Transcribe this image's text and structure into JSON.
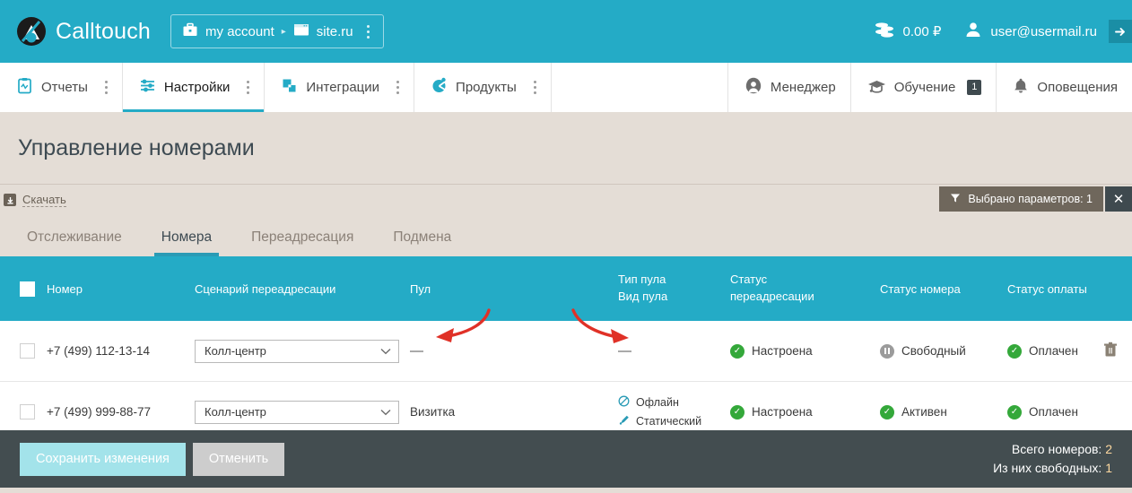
{
  "brand": {
    "name": "Calltouch",
    "logo_icon": "calltouch-logo-icon"
  },
  "topbar": {
    "account": {
      "icon": "briefcase-icon",
      "label": "my account",
      "separator": "▸"
    },
    "site": {
      "icon": "browser-window-icon",
      "label": "site.ru"
    },
    "menu_icon": "kebab-menu-icon",
    "balance": {
      "icon": "coins-icon",
      "value": "0.00 ₽"
    },
    "user": {
      "icon": "user-icon",
      "email": "user@usermail.ru"
    },
    "logout_icon": "logout-arrow-icon"
  },
  "nav": {
    "items": [
      {
        "label": "Отчеты",
        "icon": "reports-clipboard-icon",
        "active": false,
        "has_menu": true
      },
      {
        "label": "Настройки",
        "icon": "settings-sliders-icon",
        "active": true,
        "has_menu": true
      },
      {
        "label": "Интеграции",
        "icon": "integrations-squares-icon",
        "active": false,
        "has_menu": true
      },
      {
        "label": "Продукты",
        "icon": "products-icon",
        "active": false,
        "has_menu": true
      }
    ],
    "right_items": [
      {
        "label": "Менеджер",
        "icon": "manager-headset-icon",
        "badge": ""
      },
      {
        "label": "Обучение",
        "icon": "graduation-cap-icon",
        "badge": "1"
      },
      {
        "label": "Оповещения",
        "icon": "bell-icon",
        "badge": ""
      }
    ]
  },
  "page": {
    "title": "Управление номерами",
    "download": {
      "label": "Скачать",
      "icon": "download-icon"
    },
    "filter_chip": {
      "icon": "filter-funnel-icon",
      "label": "Выбрано параметров: 1",
      "close_icon": "close-icon"
    }
  },
  "subtabs": [
    {
      "label": "Отслеживание",
      "active": false
    },
    {
      "label": "Номера",
      "active": true
    },
    {
      "label": "Переадресация",
      "active": false
    },
    {
      "label": "Подмена",
      "active": false
    }
  ],
  "table": {
    "headers": {
      "number": "Номер",
      "scenario": "Сценарий переадресации",
      "pool": "Пул",
      "pool_type_1": "Тип пула",
      "pool_type_2": "Вид пула",
      "fwd_status_1": "Статус",
      "fwd_status_2": "переадресации",
      "number_status": "Статус номера",
      "payment_status": "Статус оплаты"
    },
    "rows": [
      {
        "number": "+7 (499) 112-13-14",
        "scenario": "Колл-центр",
        "pool": "—",
        "pool_type": "—",
        "pool_kind": "",
        "fwd_status": "Настроена",
        "number_status": "Свободный",
        "number_status_icon": "pause-circle-icon",
        "payment_status": "Оплачен",
        "delete_icon": "trash-icon",
        "has_delete": true
      },
      {
        "number": "+7 (499) 999-88-77",
        "scenario": "Колл-центр",
        "pool": "Визитка",
        "pool_type": "Офлайн",
        "pool_kind": "Статический",
        "fwd_status": "Настроена",
        "number_status": "Активен",
        "number_status_icon": "check-circle-icon",
        "payment_status": "Оплачен",
        "delete_icon": "trash-icon",
        "has_delete": false
      }
    ]
  },
  "footer": {
    "save_label": "Сохранить изменения",
    "cancel_label": "Отменить",
    "total_label": "Всего номеров:",
    "total_value": "2",
    "free_label": "Из них свободных:",
    "free_value": "1"
  },
  "annotations": {
    "arrow_left": "red-arrow-pointing-left",
    "arrow_right": "red-arrow-pointing-right",
    "color": "#e03127"
  },
  "colors": {
    "brand_teal": "#24abc6",
    "page_bg": "#e4ddd6",
    "footer_dark": "#434d50",
    "success_green": "#34a83a",
    "chip_brown": "#6f675c"
  }
}
